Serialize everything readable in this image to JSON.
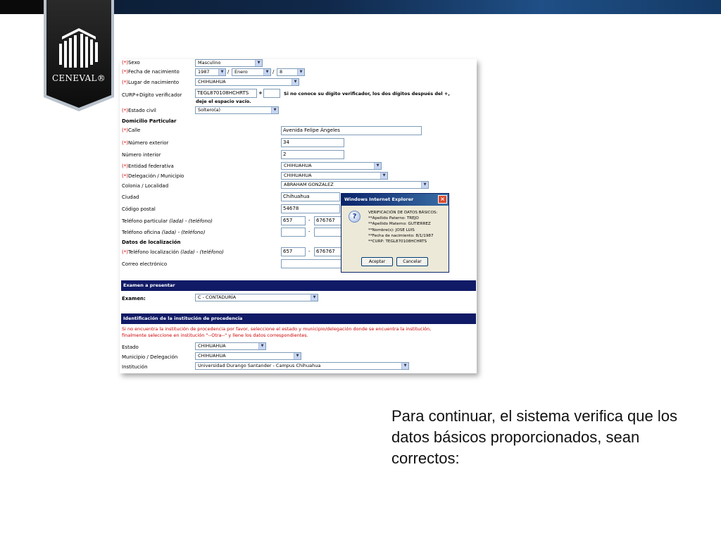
{
  "logo": {
    "text": "CENEVAL®"
  },
  "form": {
    "sexo": {
      "label": "Sexo",
      "value": "Masculino"
    },
    "fecha": {
      "label": "Fecha de nacimiento",
      "year": "1987",
      "month": "Enero",
      "day": "8",
      "sep": "/"
    },
    "lugar": {
      "label": "Lugar de nacimiento",
      "value": "CHIHUAHUA"
    },
    "curp": {
      "label": "CURP+Dígito verificador",
      "value": "TEGL870108HCHRTS",
      "plus": "+",
      "hint": "Si no conoce su dígito verificador, los dos dígitos después del +,",
      "hint2": "deje el espacio vacío."
    },
    "estado_civil": {
      "label": "Estado civil",
      "value": "Soltero(a)"
    },
    "domicilio_heading": "Domicilio Particular",
    "calle": {
      "label": "Calle",
      "value": "Avenida Felipe Ángeles"
    },
    "num_ext": {
      "label": "Número exterior",
      "value": "34"
    },
    "num_int": {
      "label": "Número interior",
      "value": "2"
    },
    "entidad": {
      "label": "Entidad federativa",
      "value": "CHIHUAHUA"
    },
    "delegacion": {
      "label": "Delegación / Municipio",
      "value": "CHIHUAHUA"
    },
    "colonia": {
      "label": "Colonia / Localidad",
      "value": "ABRAHAM GONZALEZ"
    },
    "ciudad": {
      "label": "Ciudad",
      "value": "Chihuahua"
    },
    "cp": {
      "label": "Código postal",
      "value": "54678"
    },
    "tel_part": {
      "label": "Teléfono particular",
      "paren": "(lada) - (teléfono)",
      "lada": "657",
      "dash": "-",
      "num": "676767"
    },
    "tel_ofi": {
      "label": "Teléfono oficina",
      "paren": "(lada) - (teléfono)",
      "dash": "-"
    },
    "localizacion_heading": "Datos de localización",
    "tel_loc": {
      "label": "Teléfono localización",
      "paren": "(lada) - (teléfono)",
      "lada": "657",
      "dash": "-",
      "num": "676767"
    },
    "correo": {
      "label": "Correo electrónico"
    },
    "req_mark": "(*)"
  },
  "examen": {
    "bar": "Examen a presentar",
    "label": "Examen:",
    "value": "C - CONTADURÍA"
  },
  "institucion": {
    "bar": "Identificación de la institución de procedencia",
    "note1": "Si no encuentra la institución de procedencia por favor, seleccione el estado y municipio/delegación donde se encuentra la institución,",
    "note2": "finalmente seleccione en institución \"--Otra--\" y llene los datos correspondientes.",
    "estado": {
      "label": "Estado",
      "value": "CHIHUAHUA"
    },
    "municipio": {
      "label": "Municipio / Delegación",
      "value": "CHIHUAHUA"
    },
    "inst": {
      "label": "Institución",
      "value": "Universidad Durango Santander - Campus Chihuahua"
    }
  },
  "dialog": {
    "title": "Windows Internet Explorer",
    "close": "×",
    "lines": [
      "VERIFICACIÓN DE DATOS BÁSICOS:",
      "**Apellido Paterno: TREJO",
      "**Apellido Materno: GUTIERREZ",
      "**Nombre(s): JOSE LUIS",
      "**Fecha de nacimiento: 8/1/1987",
      "**CURP: TEGL870108HCHRTS"
    ],
    "accept": "Aceptar",
    "cancel": "Cancelar"
  },
  "caption": "Para continuar, el sistema verifica que los datos básicos proporcionados, sean correctos:",
  "arrow": "▼",
  "qmark": "?"
}
